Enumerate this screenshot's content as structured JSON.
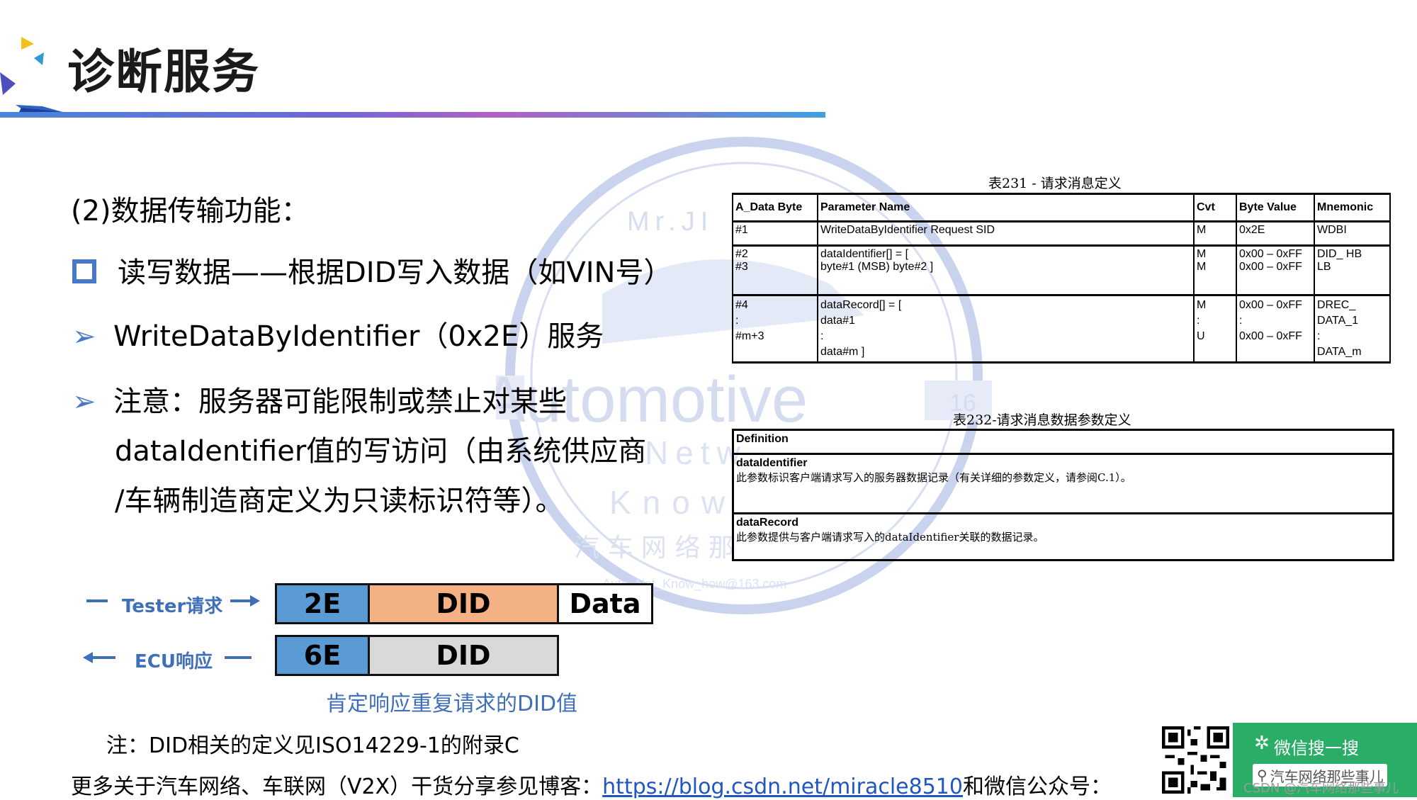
{
  "header": {
    "title": "诊断服务"
  },
  "watermark": {
    "line1": "Mr.JI",
    "line2": "Automotive",
    "line3": "Netw",
    "line4": "Know",
    "line5": "汽 车 网 络 那",
    "line6": "Auto_Net_Know_how@163.com",
    "badge": "16"
  },
  "content": {
    "subtitle": "(2)数据传输功能：",
    "bullet1": "读写数据——根据DID写入数据（如VIN号）",
    "bullet2": "WriteDataByIdentifier（0x2E）服务",
    "bullet3_line1": "注意：服务器可能限制或禁止对某些",
    "bullet3_line2": "dataIdentifier值的写访问（由系统供应商",
    "bullet3_line3": "/车辆制造商定义为只读标识符等）。"
  },
  "flow": {
    "tester_label": "Tester请求",
    "ecu_label": "ECU响应",
    "req": [
      "2E",
      "DID",
      "Data"
    ],
    "resp": [
      "6E",
      "DID"
    ],
    "caption": "肯定响应重复请求的DID值"
  },
  "note": "注：DID相关的定义见ISO14229-1的附录C",
  "footer": {
    "prefix": "更多关于汽车网络、车联网（V2X）干货分享参见博客：",
    "link": "https://blog.csdn.net/miracle8510",
    "suffix": "和微信公众号："
  },
  "table231": {
    "caption": "表231 - 请求消息定义",
    "headers": [
      "A_Data Byte",
      "Parameter Name",
      "Cvt",
      "Byte Value",
      "Mnemonic"
    ],
    "rows": [
      [
        "#1",
        "WriteDataByIdentifier Request SID",
        "M",
        "0x2E",
        "WDBI"
      ],
      [
        "#2\n#3",
        "dataIdentifier[] = [\nbyte#1 (MSB) byte#2 ]",
        "M\nM",
        "0x00 – 0xFF\n0x00 – 0xFF",
        "DID_ HB\nLB"
      ],
      [
        "#4\n:\n#m+3",
        "dataRecord[] = [\ndata#1\n:\ndata#m ]",
        "M\n:\nU",
        "0x00 – 0xFF\n:\n0x00 – 0xFF",
        "DREC_\nDATA_1\n:\nDATA_m"
      ]
    ]
  },
  "table232": {
    "caption": "表232-请求消息数据参数定义",
    "header": "Definition",
    "items": [
      {
        "name": "dataIdentifier",
        "desc": "此参数标识客户端请求写入的服务器数据记录（有关详细的参数定义，请参阅C.1）。"
      },
      {
        "name": "dataRecord",
        "desc": "此参数提供与客户端请求写入的dataIdentifier关联的数据记录。"
      }
    ]
  },
  "wechat": {
    "title": "微信搜一搜",
    "search": "汽车网络那些事儿",
    "csdn": "CSDN @汽车网络那些事儿"
  },
  "colors": {
    "blue_cell": "#5b9bd5",
    "orange_cell": "#f4b183",
    "gray_cell": "#d9d9d9",
    "accent": "#4a78c8",
    "wechat_green": "#2aae67"
  }
}
